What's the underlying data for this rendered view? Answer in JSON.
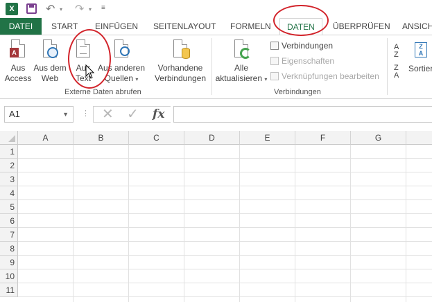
{
  "quick_access": {
    "app_icon": "excel-icon",
    "app_letter": "X",
    "save_icon": "save-icon",
    "undo_icon": "undo-icon",
    "redo_icon": "redo-icon",
    "customize_icon": "customize-arrow-icon"
  },
  "tabs": [
    {
      "label": "DATEI"
    },
    {
      "label": "START"
    },
    {
      "label": "EINFÜGEN"
    },
    {
      "label": "SEITENLAYOUT"
    },
    {
      "label": "FORMELN"
    },
    {
      "label": "DATEN"
    },
    {
      "label": "ÜBERPRÜFEN"
    },
    {
      "label": "ANSICH"
    }
  ],
  "ribbon": {
    "external_data": {
      "group_label": "Externe Daten abrufen",
      "from_access": {
        "line1": "Aus",
        "line2": "Access",
        "icon": "access-icon"
      },
      "from_web": {
        "line1": "Aus dem",
        "line2": "Web",
        "icon": "web-icon"
      },
      "from_text": {
        "line1": "Aus",
        "line2": "Text",
        "icon": "text-file-icon"
      },
      "from_other": {
        "line1": "Aus anderen",
        "line2": "Quellen",
        "icon": "other-sources-icon"
      }
    },
    "existing_connections": {
      "line1": "Vorhandene",
      "line2": "Verbindungen",
      "icon": "database-icon"
    },
    "connections": {
      "group_label": "Verbindungen",
      "refresh_all": {
        "line1": "Alle",
        "line2": "aktualisieren",
        "icon": "refresh-icon"
      },
      "connections": "Verbindungen",
      "properties": "Eigenschaften",
      "edit_links": "Verknüpfungen bearbeiten"
    },
    "sort": {
      "label": "Sortier",
      "az_top": "A",
      "az_bottom": "Z",
      "za_top": "Z",
      "za_bottom": "A"
    }
  },
  "formula_bar": {
    "name_box": "A1",
    "fx": "fx",
    "cancel_icon": "cancel-icon",
    "enter_icon": "check-icon"
  },
  "columns": [
    "A",
    "B",
    "C",
    "D",
    "E",
    "F",
    "G"
  ],
  "rows": [
    "1",
    "2",
    "3",
    "4",
    "5",
    "6",
    "7",
    "8",
    "9",
    "10",
    "11"
  ],
  "annotation_color": "#d2232a",
  "accent_color": "#217346"
}
